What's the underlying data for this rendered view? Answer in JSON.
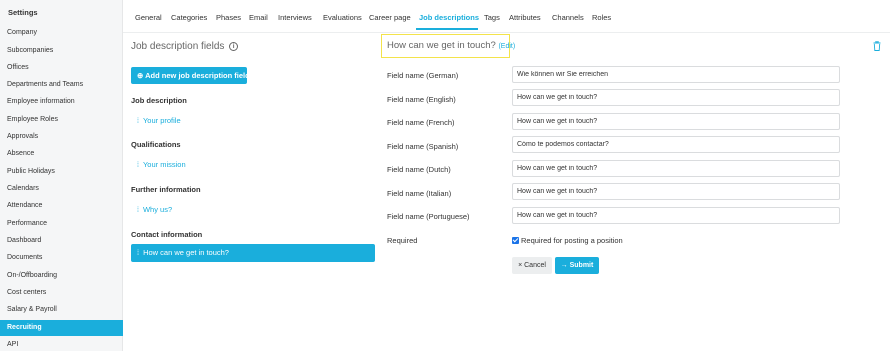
{
  "sidebar": {
    "title": "Settings",
    "items": [
      {
        "label": "Company"
      },
      {
        "label": "Subcompanies"
      },
      {
        "label": "Offices"
      },
      {
        "label": "Departments and Teams"
      },
      {
        "label": "Employee information"
      },
      {
        "label": "Employee Roles"
      },
      {
        "label": "Approvals"
      },
      {
        "label": "Absence"
      },
      {
        "label": "Public Holidays"
      },
      {
        "label": "Calendars"
      },
      {
        "label": "Attendance"
      },
      {
        "label": "Performance"
      },
      {
        "label": "Dashboard"
      },
      {
        "label": "Documents"
      },
      {
        "label": "On-/Offboarding"
      },
      {
        "label": "Cost centers"
      },
      {
        "label": "Salary & Payroll"
      },
      {
        "label": "Recruiting"
      },
      {
        "label": "API"
      }
    ],
    "active_index": 17
  },
  "tabs": [
    {
      "label": "General"
    },
    {
      "label": "Categories"
    },
    {
      "label": "Phases"
    },
    {
      "label": "Email"
    },
    {
      "label": "Interviews"
    },
    {
      "label": "Evaluations"
    },
    {
      "label": "Career page"
    },
    {
      "label": "Job descriptions"
    },
    {
      "label": "Tags"
    },
    {
      "label": "Attributes"
    },
    {
      "label": "Channels"
    },
    {
      "label": "Roles"
    }
  ],
  "left": {
    "title": "Job description fields",
    "info_icon": "i",
    "add_button": "Add new job description field",
    "groups": [
      {
        "heading": "Job description",
        "field": "Your profile"
      },
      {
        "heading": "Qualifications",
        "field": "Your mission"
      },
      {
        "heading": "Further information",
        "field": "Why us?"
      },
      {
        "heading": "Contact information",
        "field": "How can we get in touch?"
      }
    ]
  },
  "right": {
    "title": "How can we get in touch?",
    "edit_link": "(Edit)",
    "fields": [
      {
        "label": "Field name (German)",
        "value": "Wie können wir Sie erreichen"
      },
      {
        "label": "Field name (English)",
        "value": "How can we get in touch?"
      },
      {
        "label": "Field name (French)",
        "value": "How can we get in touch?"
      },
      {
        "label": "Field name (Spanish)",
        "value": "Cómo te podemos contactar?"
      },
      {
        "label": "Field name (Dutch)",
        "value": "How can we get in touch?"
      },
      {
        "label": "Field name (Italian)",
        "value": "How can we get in touch?"
      },
      {
        "label": "Field name (Portuguese)",
        "value": "How can we get in touch?"
      }
    ],
    "required_label": "Required",
    "required_checkbox_label": "Required for posting a position",
    "required_checked": true,
    "cancel_label": "Cancel",
    "submit_label": "Submit"
  },
  "colors": {
    "accent": "#1aaedc",
    "highlight": "#f3e34b"
  }
}
